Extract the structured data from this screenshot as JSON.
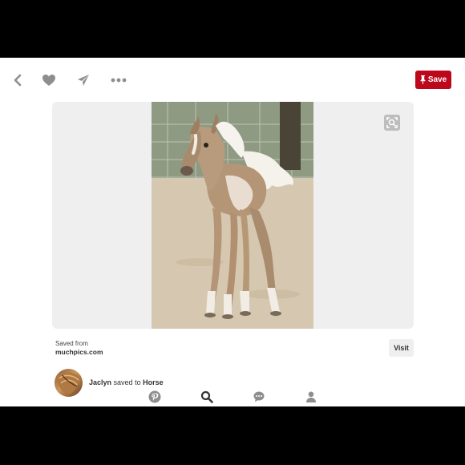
{
  "topbar": {
    "back_icon": "chevron-left-icon",
    "like_icon": "heart-icon",
    "send_icon": "paper-plane-icon",
    "more_icon": "ellipsis-icon",
    "save_label": "Save",
    "save_icon": "pushpin-icon"
  },
  "pin": {
    "image_subject": "foal",
    "visual_search_icon": "visual-search-icon",
    "saved_from_label": "Saved from",
    "source_domain": "muchpics.com",
    "visit_label": "Visit"
  },
  "pinner": {
    "name": "Jaclyn",
    "action": "saved to",
    "board": "Horse"
  },
  "tabbar": {
    "home_icon": "pinterest-logo-icon",
    "search_icon": "search-icon",
    "messages_icon": "chat-bubble-icon",
    "profile_icon": "person-icon"
  },
  "colors": {
    "brand_red": "#bd081c",
    "icon_gray": "#8e8e8e",
    "card_gray": "#efefef"
  }
}
